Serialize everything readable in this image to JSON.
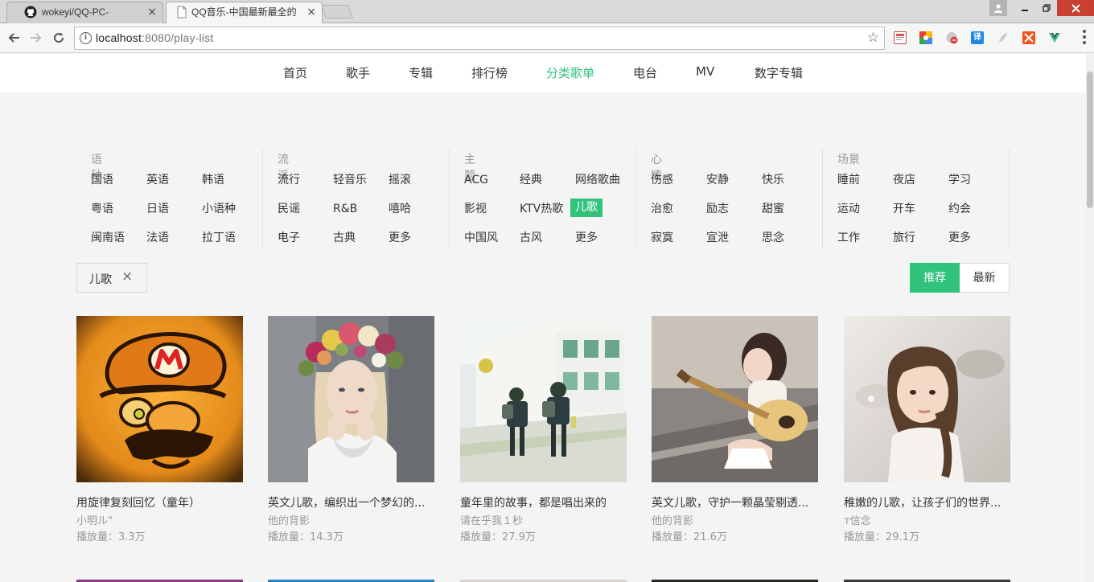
{
  "browser": {
    "tabs": [
      {
        "title": "wokeyi/QQ-PC-",
        "close": "×",
        "active": false
      },
      {
        "title": "QQ音乐-中国最新最全的",
        "close": "×",
        "active": true
      }
    ],
    "url": {
      "host": "localhost",
      "path": ":8080/play-list"
    },
    "extensions": [
      {
        "icon": "bookmark-manager-icon",
        "color": "#d9534f"
      },
      {
        "icon": "chrome-store-icon",
        "color": "#4285f4"
      },
      {
        "icon": "adblock-icon",
        "color": "#e04040"
      },
      {
        "icon": "translate-icon",
        "color": "#1e88e5",
        "glyph": "译"
      },
      {
        "icon": "feather-icon",
        "color": "#bbbbbb"
      },
      {
        "icon": "tools-icon",
        "color": "#f4511e"
      },
      {
        "icon": "vue-devtools-icon",
        "color": "#41b883"
      }
    ]
  },
  "nav": {
    "items": [
      {
        "label": "首页",
        "active": false
      },
      {
        "label": "歌手",
        "active": false
      },
      {
        "label": "专辑",
        "active": false
      },
      {
        "label": "排行榜",
        "active": false
      },
      {
        "label": "分类歌单",
        "active": true
      },
      {
        "label": "电台",
        "active": false
      },
      {
        "label": "MV",
        "active": false
      },
      {
        "label": "数字专辑",
        "active": false
      }
    ],
    "accent": "#31c27c"
  },
  "filters": [
    {
      "title": "语种",
      "items": [
        "国语",
        "英语",
        "韩语",
        "粤语",
        "日语",
        "小语种",
        "闽南语",
        "法语",
        "拉丁语"
      ]
    },
    {
      "title": "流派",
      "items": [
        "流行",
        "轻音乐",
        "摇滚",
        "民谣",
        "R&B",
        "嘻哈",
        "电子",
        "古典",
        "更多"
      ]
    },
    {
      "title": "主题",
      "items": [
        "ACG",
        "经典",
        "网络歌曲",
        "影视",
        "KTV热歌",
        "儿歌",
        "中国风",
        "古风",
        "更多"
      ],
      "selected": "儿歌"
    },
    {
      "title": "心情",
      "items": [
        "伤感",
        "安静",
        "快乐",
        "治愈",
        "励志",
        "甜蜜",
        "寂寞",
        "宣泄",
        "思念"
      ]
    },
    {
      "title": "场景",
      "items": [
        "睡前",
        "夜店",
        "学习",
        "运动",
        "开车",
        "约会",
        "工作",
        "旅行",
        "更多"
      ]
    }
  ],
  "selected_tag": {
    "label": "儿歌",
    "close": "×"
  },
  "sort": {
    "recommend": "推荐",
    "latest": "最新"
  },
  "playlists": [
    {
      "title": "用旋律复刻回忆（童年）",
      "author": "小明ル\"",
      "plays": "播放量：3.3万"
    },
    {
      "title": "英文儿歌，编织出一个梦幻的...",
      "author": "他的背影",
      "plays": "播放量：14.3万"
    },
    {
      "title": "童年里的故事，都是唱出来的",
      "author": "请在乎我１秒",
      "plays": "播放量：27.9万"
    },
    {
      "title": "英文儿歌，守护一颗晶莹剔透...",
      "author": "他的背影",
      "plays": "播放量：21.6万"
    },
    {
      "title": "稚嫩的儿歌，让孩子们的世界...",
      "author": "т信念",
      "plays": "播放量：29.1万"
    }
  ]
}
